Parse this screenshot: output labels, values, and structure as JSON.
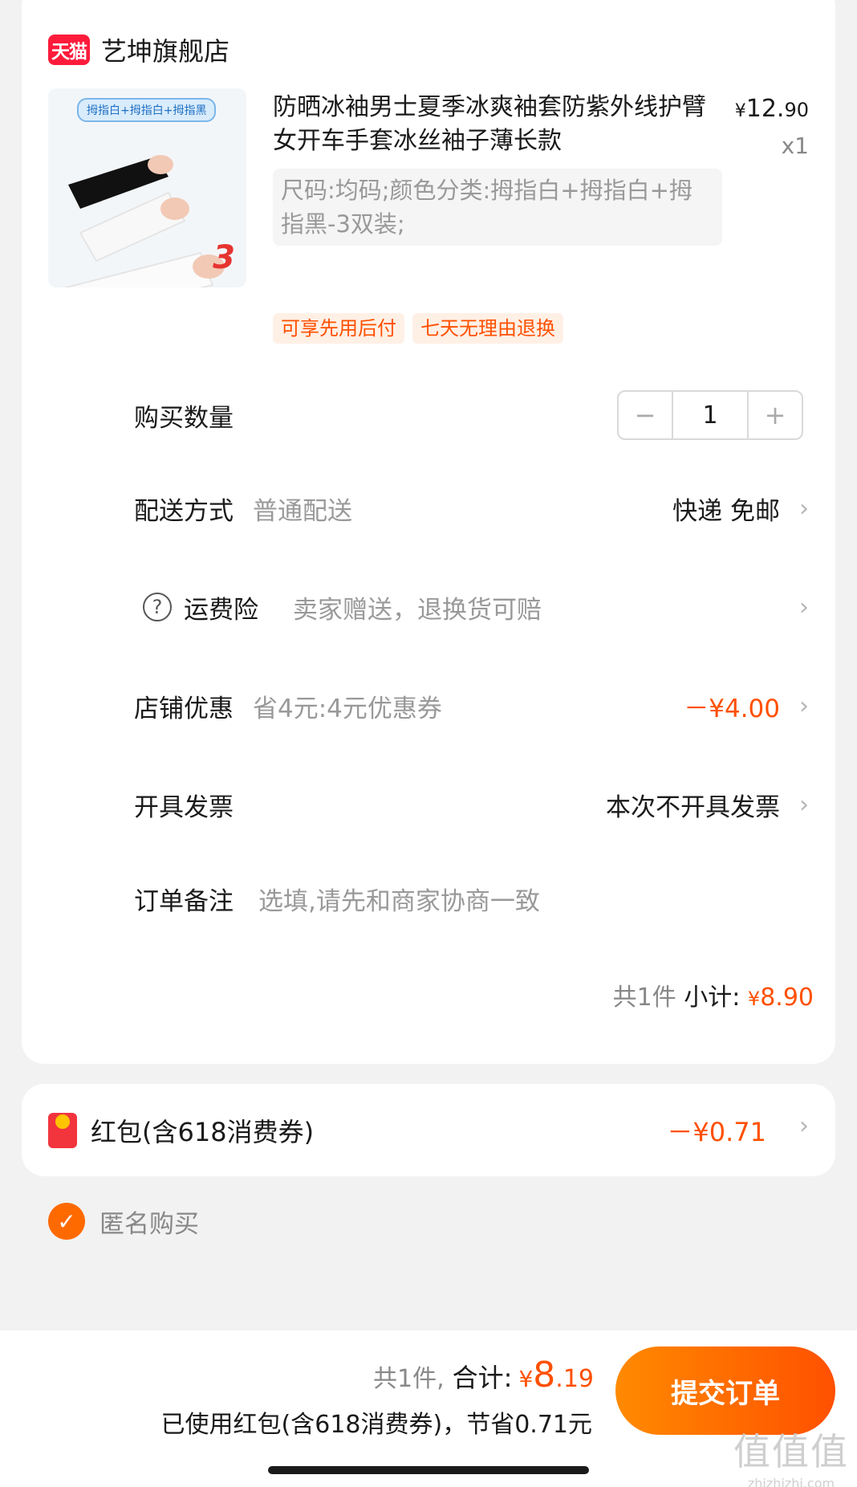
{
  "shop": {
    "badge": "天猫",
    "name": "艺坤旗舰店"
  },
  "product": {
    "image_banner": "拇指白+拇指白+拇指黑",
    "image_badge": "3",
    "title": "防晒冰袖男士夏季冰爽袖套防紫外线护臂女开车手套冰丝袖子薄长款",
    "price_currency": "¥",
    "price_int": "12.",
    "price_dec": "90",
    "quantity": "x1",
    "sku": "尺码:均码;颜色分类:拇指白+拇指白+拇指黑-3双装;",
    "tags": [
      "可享先用后付",
      "七天无理由退换"
    ]
  },
  "quantity_row": {
    "label": "购买数量",
    "value": "1",
    "minus": "−",
    "plus": "+"
  },
  "delivery": {
    "label": "配送方式",
    "sub": "普通配送",
    "value": "快递 免邮"
  },
  "insurance": {
    "label": "运费险",
    "sub": "卖家赠送，退换货可赔"
  },
  "shop_discount": {
    "label": "店铺优惠",
    "sub": "省4元:4元优惠券",
    "value": "－¥4.00"
  },
  "invoice": {
    "label": "开具发票",
    "value": "本次不开具发票"
  },
  "remark": {
    "label": "订单备注",
    "placeholder": "选填,请先和商家协商一致"
  },
  "subtotal": {
    "count": "共1件",
    "label": "小计:",
    "currency": "¥",
    "amount": "8.90"
  },
  "red_packet": {
    "label": "红包(含618消费券)",
    "value": "－¥0.71"
  },
  "anonymous": {
    "label": "匿名购买",
    "checked": true
  },
  "bottom": {
    "count": "共1件,",
    "total_label": "合计:",
    "currency": "¥",
    "total_int": "8",
    "total_dec": ".19",
    "saving": "已使用红包(含618消费券)，节省0.71元",
    "submit": "提交订单"
  },
  "watermark": {
    "big": "值值值",
    "small": "zhizhizhi.com"
  },
  "colors": {
    "accent": "#ff5000",
    "tmall_red": "#ff1b3b"
  }
}
